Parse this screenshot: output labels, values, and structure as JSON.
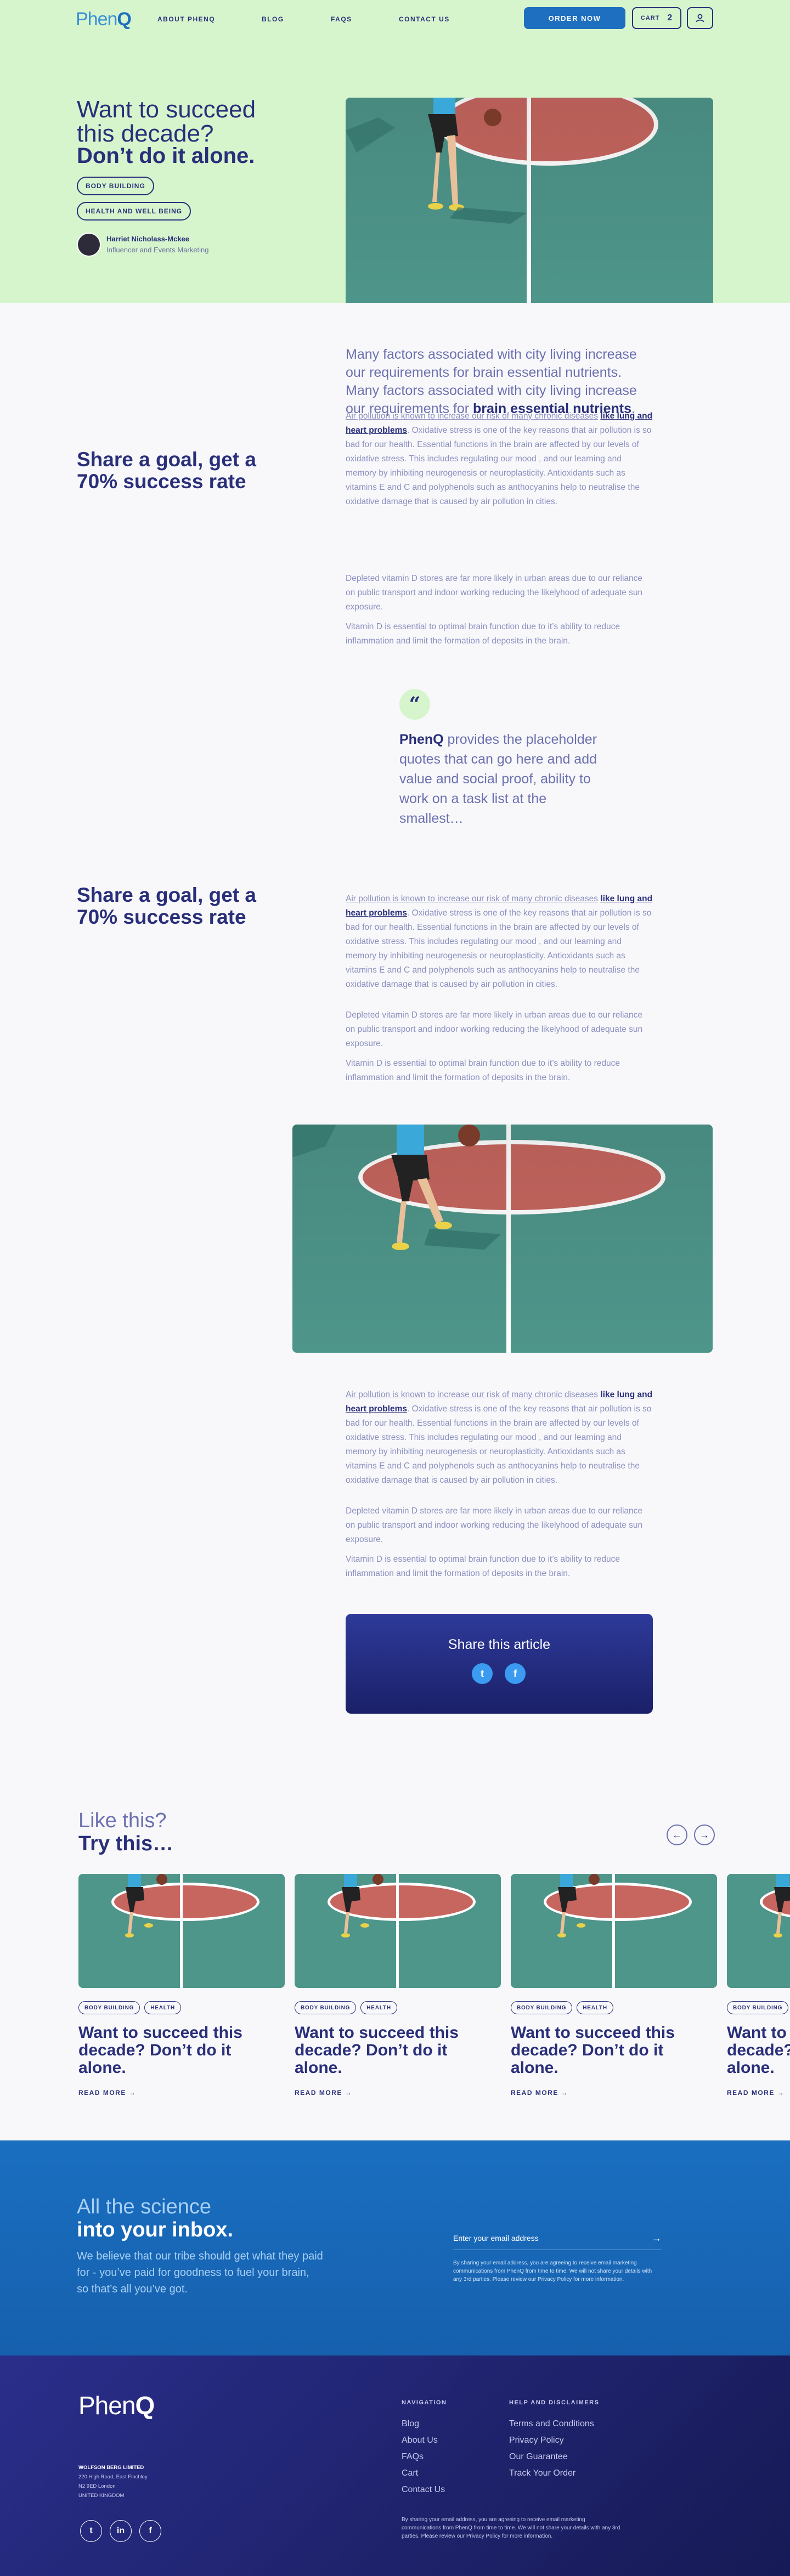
{
  "nav": {
    "logo_light": "Phen",
    "logo_bold": "Q",
    "links": [
      "ABOUT PHENQ",
      "BLOG",
      "FAQS",
      "CONTACT US"
    ],
    "order_label": "ORDER NOW",
    "cart_label": "CART",
    "cart_count": "2"
  },
  "hero": {
    "title_line1": "Want to succeed",
    "title_line2": "this decade?",
    "title_bold": "Don’t do it alone.",
    "tags": [
      "BODY BUILDING",
      "HEALTH AND WELL BEING"
    ],
    "author_name": "Harriet Nicholass-Mckee",
    "author_role": "Influencer and Events Marketing"
  },
  "article": {
    "lead_normal": "Many factors associated with city living increase our requirements for brain essential nutrients. Many factors associated with city living increase our requirements for ",
    "lead_bold": "brain essential nutrients",
    "lead_end": ".",
    "section_title": "Share a goal, get a 70% success rate",
    "p1_link": "Air pollution is known to increase our risk of many chronic diseases",
    "p1_bold": "like lung and heart problems",
    "p1_rest": ". Oxidative stress is one of the key reasons that air pollution is so bad for our health. Essential functions in the brain are affected by our levels of oxidative stress. This includes regulating our mood , and our learning and memory by inhibiting neurogenesis or neuroplasticity. Antioxidants such as vitamins E and C and polyphenols such as anthocyanins help to neutralise the oxidative damage that is caused by air pollution in cities.",
    "p2": "Depleted vitamin D stores are far more likely in urban areas due to our reliance on public transport and indoor working reducing the likelyhood of adequate sun exposure.",
    "p3": "Vitamin D is essential to optimal brain function due to it’s ability to reduce inflammation and limit the formation of deposits in the brain.",
    "quote_mark": "“",
    "quote_bold": "PhenQ",
    "quote_text": " provides the placeholder quotes that can go here and add value and social proof, ability to work on a task list at the smallest…",
    "share_title": "Share this article"
  },
  "related": {
    "title_light": "Like this?",
    "title_bold": "Try this…",
    "prev_icon": "arrow-left-icon",
    "next_icon": "arrow-right-icon",
    "cards": [
      {
        "tags": [
          "BODY BUILDING",
          "HEALTH"
        ],
        "title": "Want to succeed this decade? Don’t do it alone.",
        "link": "READ MORE"
      },
      {
        "tags": [
          "BODY BUILDING",
          "HEALTH"
        ],
        "title": "Want to succeed this decade? Don’t do it alone.",
        "link": "READ MORE"
      },
      {
        "tags": [
          "BODY BUILDING",
          "HEALTH"
        ],
        "title": "Want to succeed this decade? Don’t do it alone.",
        "link": "READ MORE"
      },
      {
        "tags": [
          "BODY BUILDING"
        ],
        "title": "Want to succeed this decade? Don’t do it alone.",
        "link": "READ MORE"
      }
    ]
  },
  "newsletter": {
    "title_light": "All the science",
    "title_bold": "into your inbox.",
    "text": "We believe that our tribe should get what they paid for - you’ve paid for goodness to fuel your brain, so that’s all you’ve got.",
    "placeholder": "Enter your email address",
    "small": "By sharing your email address, you are agreeing to receive email marketing communications from PhenQ from time to time. We will not share your details with any 3rd parties. Please review our Privacy Policy for more information."
  },
  "footer": {
    "logo_light": "Phen",
    "logo_bold": "Q",
    "company": "WOLFSON BERG LIMITED",
    "address": [
      "220 High Road, East Finchley",
      "N2 9ED London",
      "UNITED KINGDOM"
    ],
    "nav_heading": "NAVIGATION",
    "nav_links": [
      "Blog",
      "About Us",
      "FAQs",
      "Cart",
      "Contact Us"
    ],
    "help_heading": "HELP AND DISCLAIMERS",
    "help_links": [
      "Terms and Conditions",
      "Privacy Policy",
      "Our Guarantee",
      "Track Your Order"
    ],
    "note": "By sharing your email address, you are agreeing to receive email marketing communications from PhenQ from time to time. We will not share your details with any 3rd parties. Please review our Privacy Policy for more information."
  },
  "colors": {
    "primary": "#1f6fc0",
    "navy": "#2a2f7a",
    "mint": "#d6f5cc",
    "court": "#4e958a"
  }
}
